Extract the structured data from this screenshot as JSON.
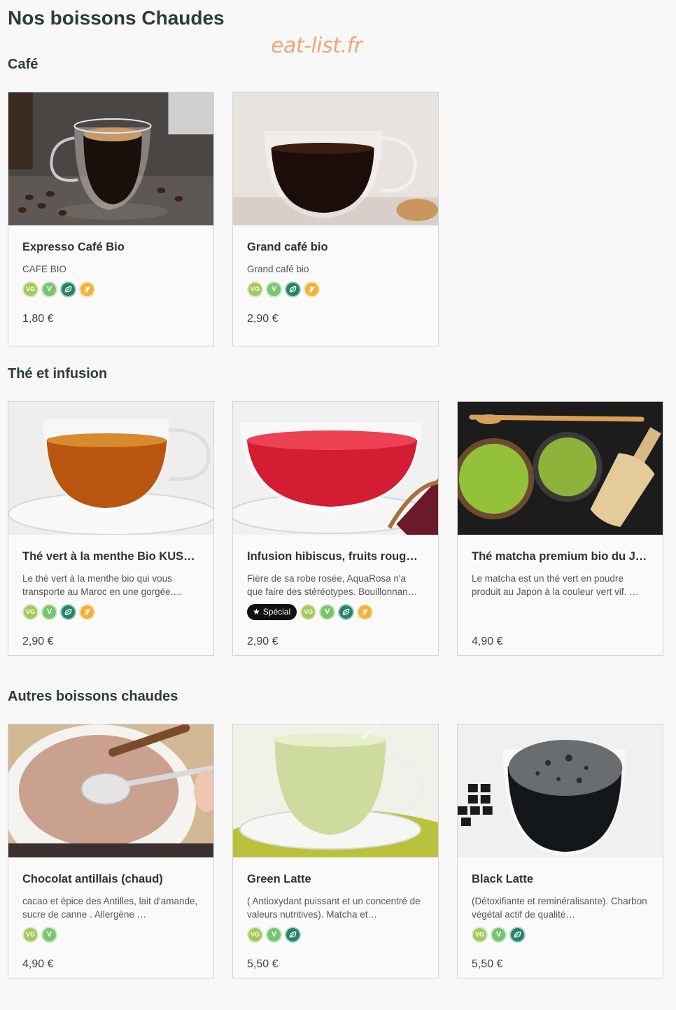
{
  "page_title": "Nos boissons Chaudes",
  "watermark": "eat-list.fr",
  "sections": [
    {
      "title": "Café",
      "items": [
        {
          "name": "Expresso Café Bio",
          "desc": "CAFE BIO",
          "price": "1,80 €",
          "special": null,
          "badges": [
            "VG",
            "V",
            "eco",
            "gluten"
          ]
        },
        {
          "name": "Grand café bio",
          "desc": "Grand café bio",
          "price": "2,90 €",
          "special": null,
          "badges": [
            "VG",
            "V",
            "eco",
            "gluten"
          ]
        }
      ]
    },
    {
      "title": "Thé et infusion",
      "items": [
        {
          "name": "Thé vert à la menthe Bio KUSM…",
          "desc": "Le thé vert à la menthe bio qui vous transporte au Maroc en une gorgée.…",
          "price": "2,90 €",
          "special": null,
          "badges": [
            "VG",
            "V",
            "eco",
            "gluten"
          ]
        },
        {
          "name": "Infusion hibiscus, fruits rouges…",
          "desc": "Fière de sa robe rosée, AquaRosa n'a que faire des stéréotypes. Bouillonnan…",
          "price": "2,90 €",
          "special": "Spécial",
          "badges": [
            "VG",
            "V",
            "eco",
            "gluten"
          ]
        },
        {
          "name": "Thé matcha premium bio du Ja…",
          "desc": "Le matcha est un thé vert en poudre produit au Japon à la couleur vert vif. …",
          "price": "4,90 €",
          "special": null,
          "badges": []
        }
      ]
    },
    {
      "title": "Autres boissons chaudes",
      "items": [
        {
          "name": "Chocolat antillais (chaud)",
          "desc": "cacao et épice des Antilles, lait d'amande, sucre de canne . Allergène …",
          "price": "4,90 €",
          "special": null,
          "badges": [
            "VG",
            "V"
          ]
        },
        {
          "name": "Green Latte",
          "desc": "( Antioxydant puissant et un concentré de valeurs nutritives). Matcha et…",
          "price": "5,50 €",
          "special": null,
          "badges": [
            "VG",
            "V",
            "eco"
          ]
        },
        {
          "name": "Black Latte",
          "desc": "(Détoxifiante et reminéralisante). Charbon végétal actif de qualité…",
          "price": "5,50 €",
          "special": null,
          "badges": [
            "VG",
            "V",
            "eco"
          ]
        }
      ]
    }
  ],
  "badge_labels": {
    "vg": "VG",
    "v": "V"
  },
  "colors": {
    "vg": "#a6c85a",
    "v": "#79c46e",
    "eco": "#22836a",
    "gluten": "#efb23d",
    "watermark": "#f0a57a"
  }
}
